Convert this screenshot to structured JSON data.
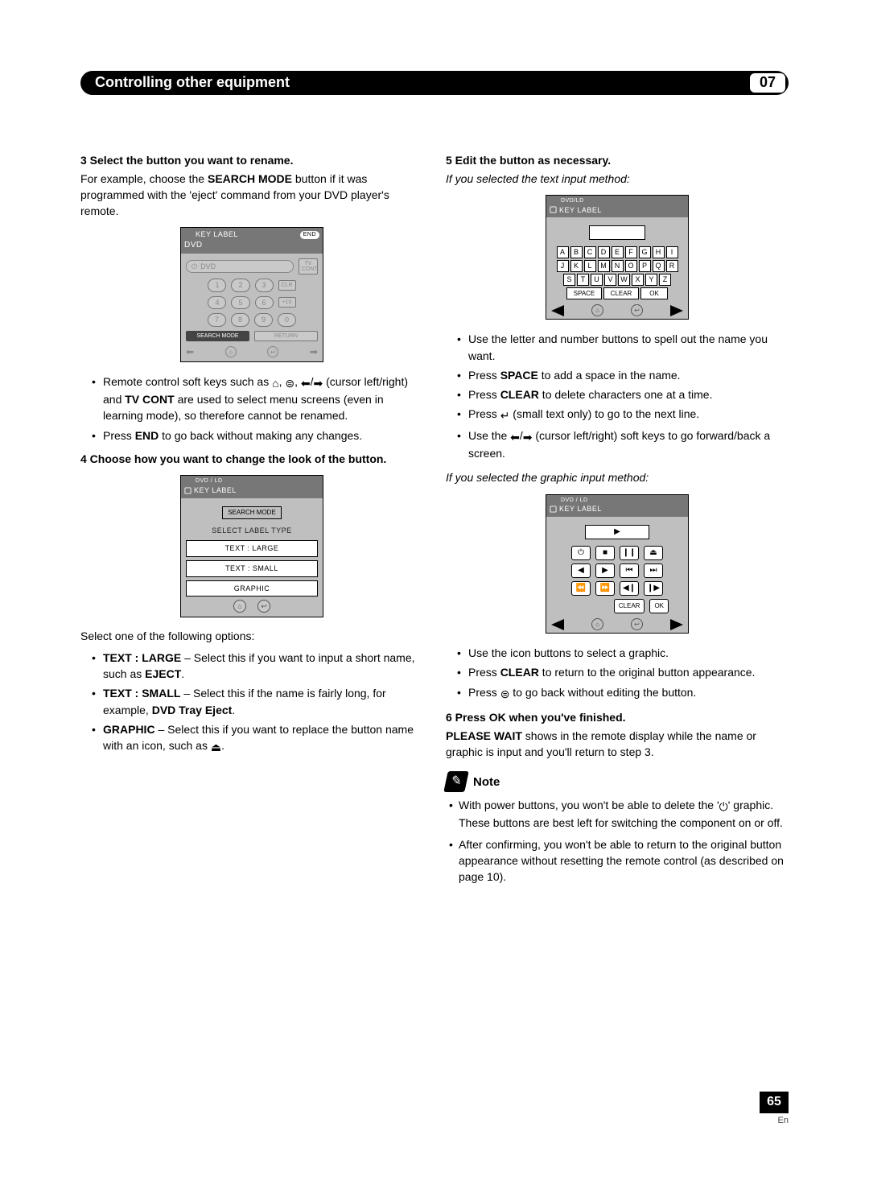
{
  "chapter": {
    "title": "Controlling other equipment",
    "number": "07"
  },
  "page": {
    "number": "65",
    "lang": "En"
  },
  "left": {
    "step3": {
      "head": "3   Select the button you want to rename.",
      "para1_a": "For example, choose the ",
      "para1_b": "SEARCH MODE",
      "para1_c": " button if it was programmed with the 'eject' command from your DVD player's remote."
    },
    "diag1": {
      "top_small": "KEY LABEL",
      "end": "END",
      "title": "DVD",
      "dvd_label": "DVD",
      "tvcont": "TV CONT",
      "r1": [
        "1",
        "2",
        "3"
      ],
      "r1x": "CLR",
      "r2": [
        "4",
        "5",
        "6"
      ],
      "r2x": "+10",
      "r3": [
        "7",
        "8",
        "9"
      ],
      "r3x": "0",
      "search": "SEARCH MODE",
      "return": "RETURN"
    },
    "step3_bullets": {
      "b1_a": "Remote control soft keys such as ",
      "b1_b": " (cursor left/right) and ",
      "b1_c": "TV CONT",
      "b1_d": " are used to select menu screens (even in learning mode), so therefore cannot be renamed.",
      "b2_a": "Press ",
      "b2_b": "END",
      "b2_c": " to go back without making any changes."
    },
    "step4": {
      "head": "4   Choose how you want to change the look of the button."
    },
    "diag2": {
      "top_small": "DVD / LD",
      "title": "KEY LABEL",
      "mode": "SEARCH MODE",
      "sub": "SELECT LABEL TYPE",
      "opt1": "TEXT  :  LARGE",
      "opt2": "TEXT  :  SMALL",
      "opt3": "GRAPHIC"
    },
    "select_line": "Select one of the following options:",
    "opts": {
      "o1_a": "TEXT : LARGE",
      "o1_b": " – Select this if you want to input a short name, such as ",
      "o1_c": "EJECT",
      "o1_d": ".",
      "o2_a": "TEXT : SMALL",
      "o2_b": " – Select this if the name is fairly long, for example, ",
      "o2_c": "DVD Tray Eject",
      "o2_d": ".",
      "o3_a": "GRAPHIC",
      "o3_b": " – Select this if you want to replace the button name with an icon, such as ",
      "o3_c": "."
    }
  },
  "right": {
    "step5": {
      "head": "5   Edit the button as necessary.",
      "if_text": "If you selected the text input method:"
    },
    "diag3": {
      "top_small": "DVD/LD",
      "title": "KEY LABEL",
      "row1": [
        "A",
        "B",
        "C",
        "D",
        "E",
        "F",
        "G",
        "H",
        "I"
      ],
      "row2": [
        "J",
        "K",
        "L",
        "M",
        "N",
        "O",
        "P",
        "Q",
        "R"
      ],
      "row3": [
        "S",
        "T",
        "U",
        "V",
        "W",
        "X",
        "Y",
        "Z"
      ],
      "space": "SPACE",
      "clear": "CLEAR",
      "ok": "OK"
    },
    "text_bullets": {
      "b1": "Use the letter and number buttons to spell out the name you want.",
      "b2_a": "Press ",
      "b2_b": "SPACE",
      "b2_c": " to add a space in the name.",
      "b3_a": "Press ",
      "b3_b": "CLEAR",
      "b3_c": " to delete characters one at a time.",
      "b4_a": "Press ",
      "b4_b": " (small text only) to go to the next line.",
      "b5_a": "Use the ",
      "b5_b": " (cursor left/right) soft keys to go forward/back a screen."
    },
    "if_graphic": "If you selected the graphic input method:",
    "diag4": {
      "top_small": "DVD / LD",
      "title": "KEY LABEL",
      "field_glyph": "▶",
      "row1": [
        "⏻",
        "■",
        "❙❙",
        "⏏"
      ],
      "row2": [
        "◀",
        "▶",
        "⏮",
        "⏭"
      ],
      "row3": [
        "⏪",
        "⏩",
        "◀❙",
        "❙▶"
      ],
      "clear": "CLEAR",
      "ok": "OK"
    },
    "graphic_bullets": {
      "b1": "Use the icon buttons to select a graphic.",
      "b2_a": "Press ",
      "b2_b": "CLEAR",
      "b2_c": " to return to the original button appearance.",
      "b3_a": "Press ",
      "b3_b": " to go back without editing the button."
    },
    "step6": {
      "head": "6   Press OK when you've finished.",
      "para_a": "PLEASE WAIT",
      "para_b": " shows in the remote display while the name or graphic is input and you'll return to step 3."
    },
    "note": {
      "label": "Note",
      "n1_a": "With power buttons, you won't be able to delete the '",
      "n1_b": "' graphic. These buttons are best left for switching the component on or off.",
      "n2": "After confirming, you won't be able to return to the original button appearance without resetting the remote control (as described on page 10)."
    }
  }
}
